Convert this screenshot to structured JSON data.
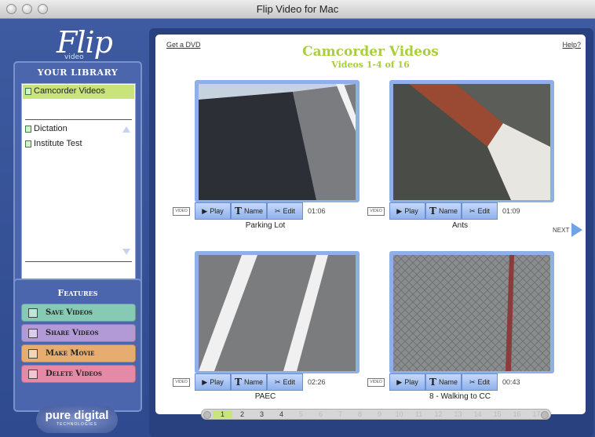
{
  "window": {
    "title": "Flip Video for Mac"
  },
  "brand": {
    "logo": "Flip",
    "logo_sub": "video",
    "footer_main": "pure digital",
    "footer_sub": "TECHNOLOGIES"
  },
  "library": {
    "title": "Your Library",
    "items": [
      {
        "label": "Camcorder Videos",
        "selected": true
      },
      {
        "label": "Dictation"
      },
      {
        "label": "Institute Test"
      }
    ]
  },
  "features": {
    "title": "Features",
    "buttons": [
      {
        "label": "Save Videos",
        "color": "#86c9b4"
      },
      {
        "label": "Share Videos",
        "color": "#b29ad6"
      },
      {
        "label": "Make Movie",
        "color": "#e7ad70"
      },
      {
        "label": "Delete Videos",
        "color": "#e48aa6"
      }
    ]
  },
  "main": {
    "get_dvd": "Get a DVD",
    "help": "Help?",
    "title": "Camcorder Videos",
    "subtitle": "Videos 1-4 of 16",
    "next": "NEXT",
    "tag": "VIDEO",
    "play": "Play",
    "name": "Name",
    "edit": "Edit",
    "videos": [
      {
        "name": "Parking Lot",
        "duration": "01:06"
      },
      {
        "name": "Ants",
        "duration": "01:09"
      },
      {
        "name": "PAEC",
        "duration": "02:26"
      },
      {
        "name": "8 - Walking to CC",
        "duration": "00:43"
      }
    ],
    "pages": [
      "1",
      "2",
      "3",
      "4",
      "5",
      "6",
      "7",
      "8",
      "9",
      "10",
      "11",
      "12",
      "13",
      "14",
      "15",
      "16",
      "17"
    ],
    "current_page": "1",
    "active_pages": [
      "1",
      "2",
      "3",
      "4"
    ]
  }
}
